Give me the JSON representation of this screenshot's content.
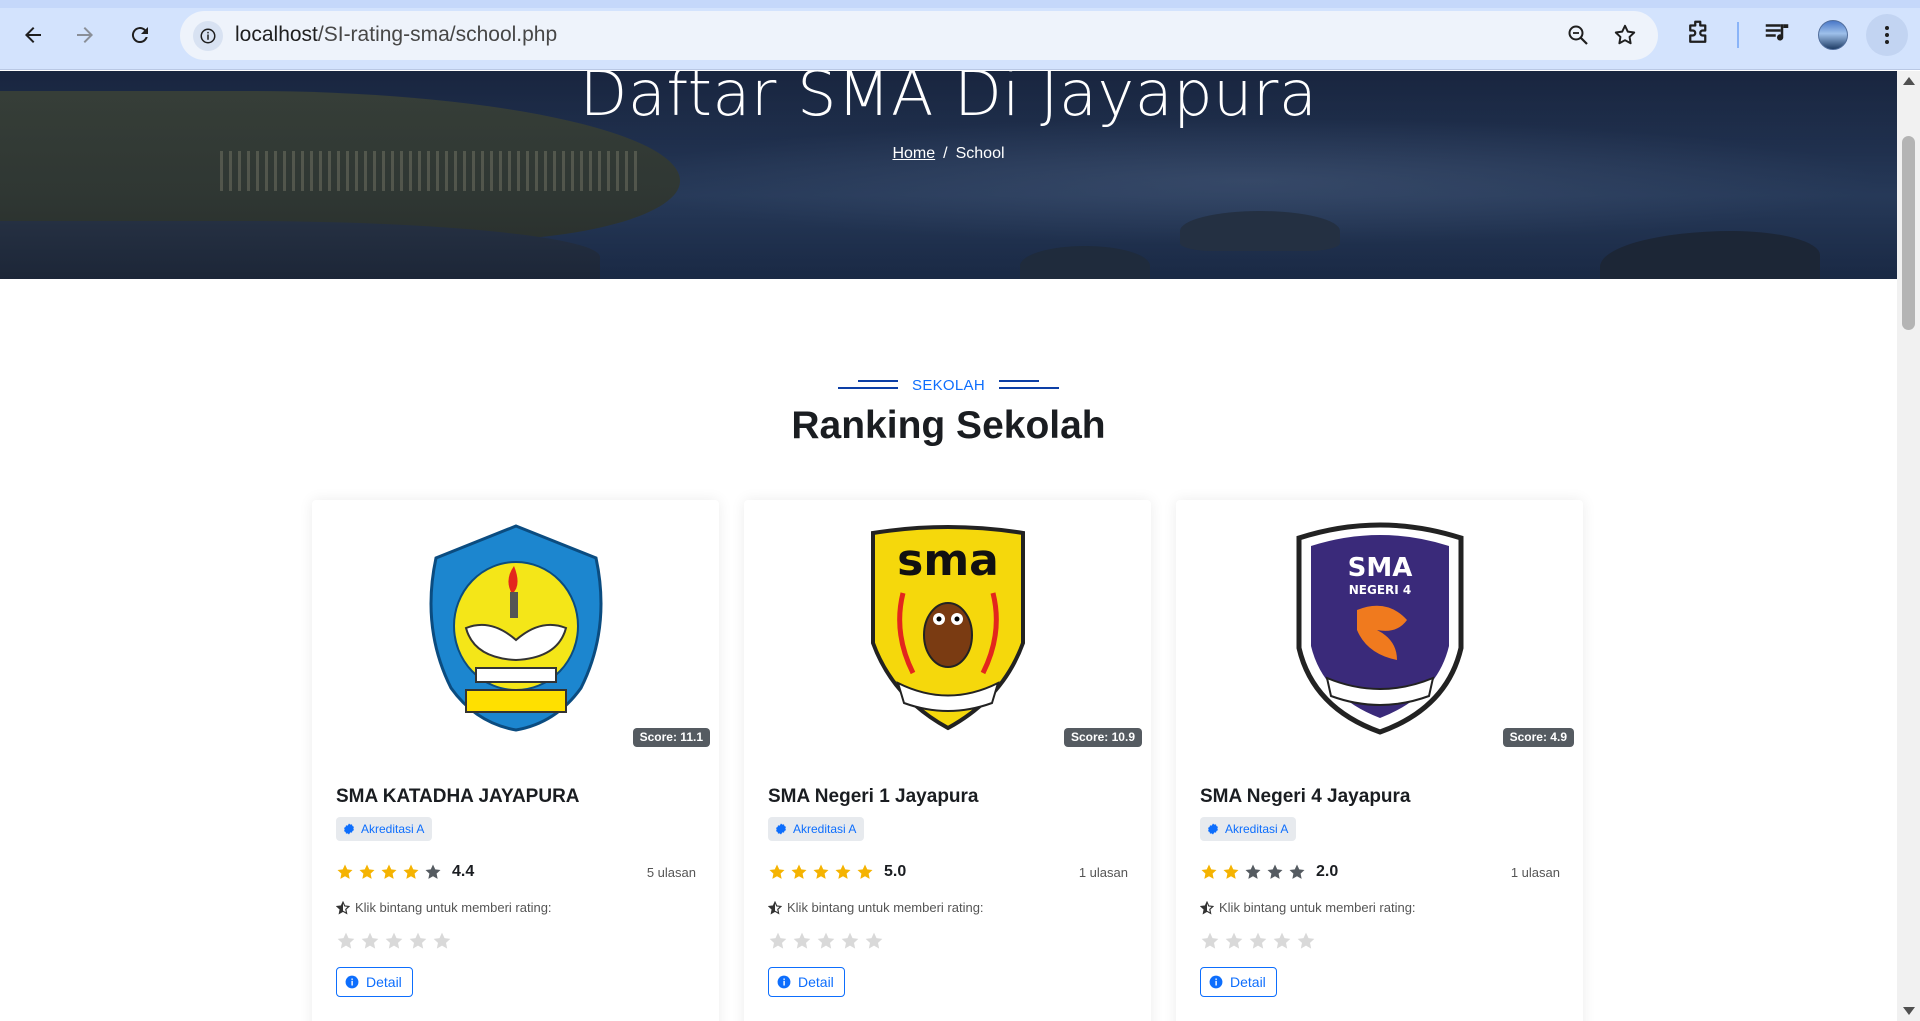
{
  "browser": {
    "url_host": "localhost",
    "url_path": "/SI-rating-sma/school.php"
  },
  "hero": {
    "title": "Daftar SMA Di Jayapura",
    "breadcrumb_home": "Home",
    "breadcrumb_separator": "/",
    "breadcrumb_current": "School"
  },
  "section": {
    "eyebrow": "SEKOLAH",
    "title": "Ranking Sekolah"
  },
  "colors": {
    "accent": "#0d6efd",
    "star_filled": "#f5b301",
    "star_empty_dark": "#555b61",
    "star_rate": "#d9d9d9"
  },
  "cards": [
    {
      "name": "SMA KATADHA JAYAPURA",
      "score": "Score: 11.1",
      "accreditation": "Akreditasi A",
      "rating": 4.4,
      "rating_label": "4.4",
      "reviews": "5 ulasan",
      "filled_stars": 4,
      "hint": "Klik bintang untuk memberi rating:",
      "detail": "Detail",
      "logo": "sma-yppk-taruna-dharma-logo"
    },
    {
      "name": "SMA Negeri 1 Jayapura",
      "score": "Score: 10.9",
      "accreditation": "Akreditasi A",
      "rating": 5.0,
      "rating_label": "5.0",
      "reviews": "1 ulasan",
      "filled_stars": 5,
      "hint": "Klik bintang untuk memberi rating:",
      "detail": "Detail",
      "logo": "sma-owl-logo"
    },
    {
      "name": "SMA Negeri 4 Jayapura",
      "score": "Score: 4.9",
      "accreditation": "Akreditasi A",
      "rating": 2.0,
      "rating_label": "2.0",
      "reviews": "1 ulasan",
      "filled_stars": 2,
      "hint": "Klik bintang untuk memberi rating:",
      "detail": "Detail",
      "logo": "sma-negeri-4-logo"
    }
  ]
}
